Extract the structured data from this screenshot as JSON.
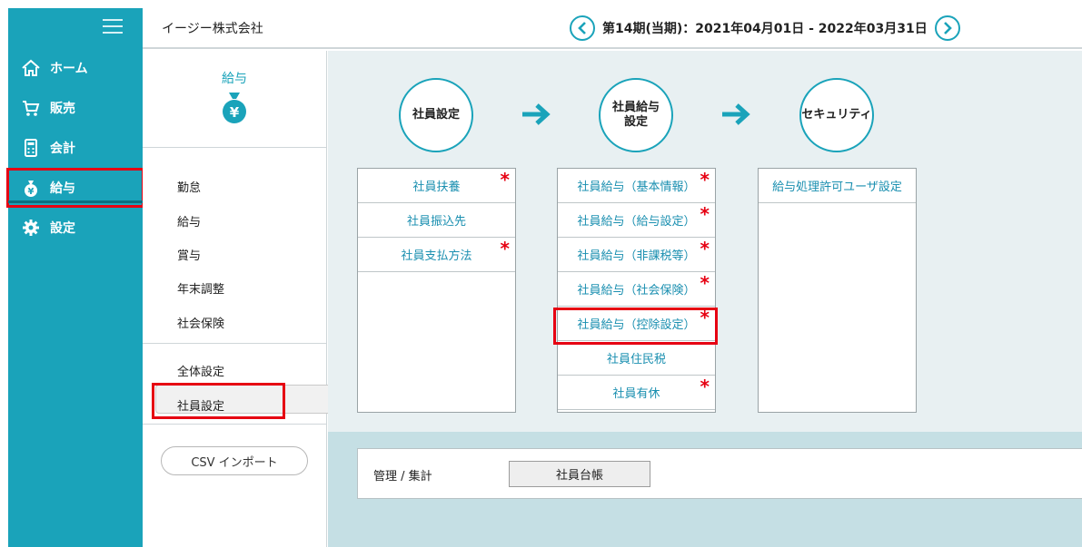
{
  "app": {
    "company_name": "イージー株式会社",
    "period_label": "第14期(当期)：2021年04月01日 - 2022年03月31日"
  },
  "left_nav": {
    "items": [
      {
        "label": "ホーム",
        "icon": "home-icon"
      },
      {
        "label": "販売",
        "icon": "cart-icon"
      },
      {
        "label": "会計",
        "icon": "calculator-icon"
      },
      {
        "label": "給与",
        "icon": "money-bag-icon",
        "active": true
      },
      {
        "label": "設定",
        "icon": "gear-icon"
      }
    ]
  },
  "sub_nav": {
    "title": "給与",
    "items": [
      "勤怠",
      "給与",
      "賞与",
      "年末調整",
      "社会保険"
    ],
    "settings_items": [
      "全体設定",
      "社員設定"
    ],
    "selected": "社員設定",
    "csv_button": "CSV インポート"
  },
  "flow": {
    "steps": [
      {
        "label": "社員設定"
      },
      {
        "label_line1": "社員給与",
        "label_line2": "設定"
      },
      {
        "label": "セキュリティ"
      }
    ]
  },
  "panels": {
    "employee_settings": [
      {
        "label": "社員扶養",
        "required": true,
        "star": "*"
      },
      {
        "label": "社員振込先",
        "required": false
      },
      {
        "label": "社員支払方法",
        "required": true,
        "star": "*"
      }
    ],
    "employee_salary": [
      {
        "label": "社員給与（基本情報）",
        "required": true,
        "star": "*"
      },
      {
        "label": "社員給与（給与設定）",
        "required": true,
        "star": "*"
      },
      {
        "label": "社員給与（非課税等）",
        "required": true,
        "star": "*"
      },
      {
        "label": "社員給与（社会保険）",
        "required": true,
        "star": "*"
      },
      {
        "label": "社員給与（控除設定）",
        "required": true,
        "star": "*",
        "highlighted": true
      },
      {
        "label": "社員住民税",
        "required": false
      },
      {
        "label": "社員有休",
        "required": true,
        "star": "*"
      }
    ],
    "security": [
      {
        "label": "給与処理許可ユーザ設定",
        "required": false
      }
    ]
  },
  "management": {
    "label": "管理 / 集計",
    "ledger_button": "社員台帳"
  },
  "colors": {
    "accent": "#1aa3ba",
    "highlight": "#e60012",
    "link": "#1a8fb0"
  }
}
